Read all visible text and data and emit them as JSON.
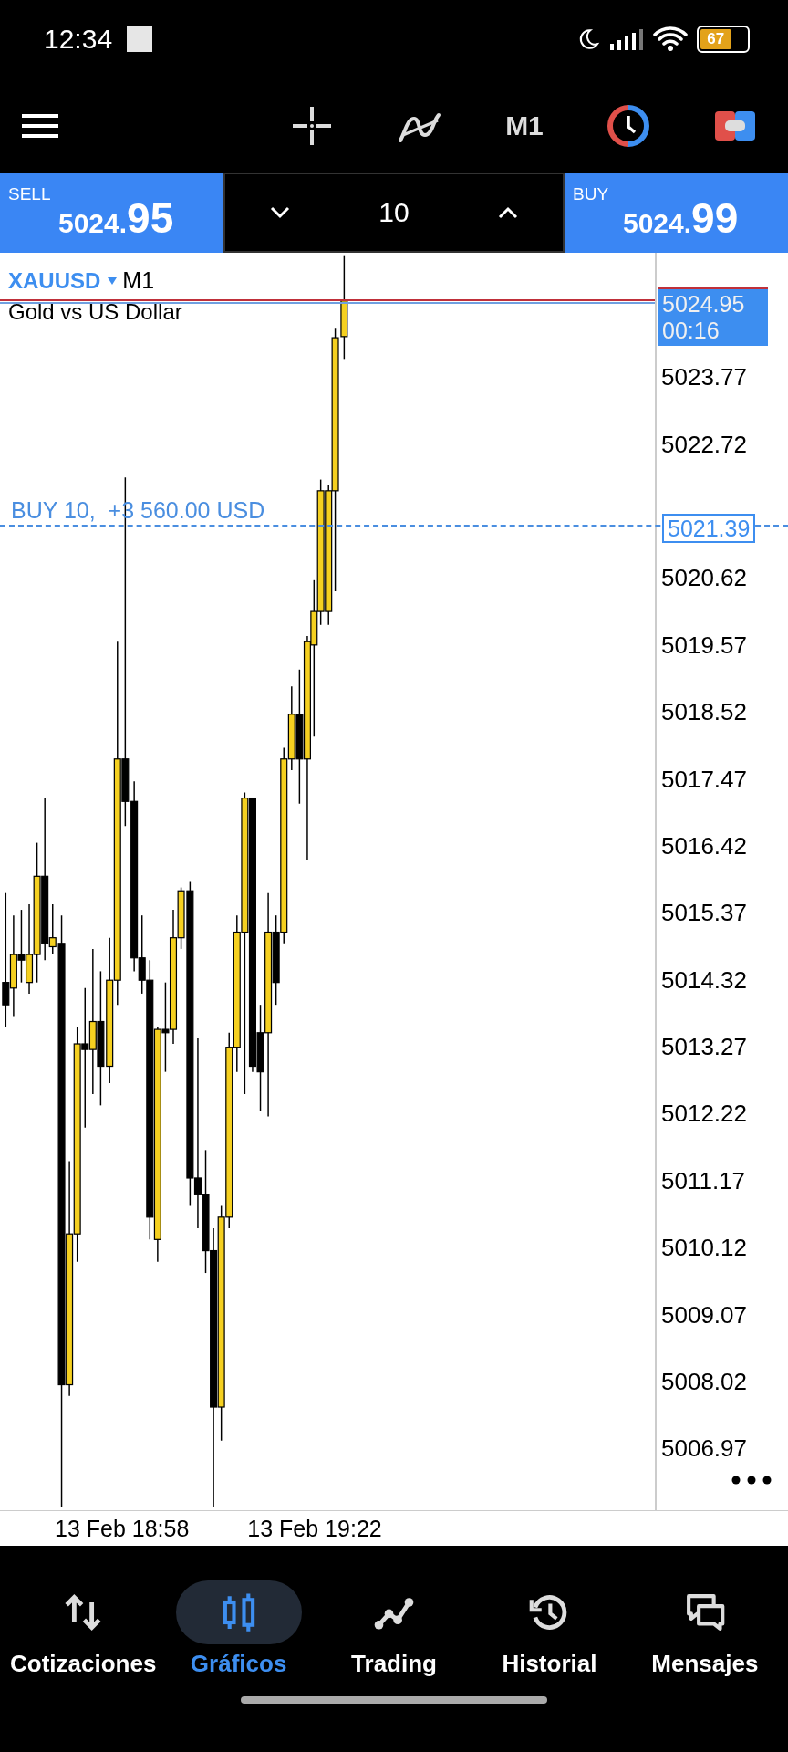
{
  "status_bar": {
    "time": "12:34",
    "battery": "67"
  },
  "toolbar": {
    "timeframe": "M1"
  },
  "trade_panel": {
    "sell": {
      "label": "SELL",
      "price_main": "5024.",
      "price_big": "95"
    },
    "volume": "10",
    "buy": {
      "label": "BUY",
      "price_main": "5024.",
      "price_big": "99"
    }
  },
  "chart": {
    "symbol": "XAUUSD",
    "timeframe": "M1",
    "description": "Gold vs US Dollar",
    "position_label": "BUY 10,  +3 560.00 USD",
    "current_price": "5024.95",
    "countdown": "00:16",
    "position_price": "5021.39",
    "price_axis_upper": [
      "5023.77",
      "5022.72"
    ],
    "price_axis_lower": [
      "5020.62",
      "5019.57",
      "5018.52",
      "5017.47",
      "5016.42",
      "5015.37",
      "5014.32",
      "5013.27",
      "5012.22",
      "5011.17",
      "5010.12",
      "5009.07",
      "5008.02",
      "5006.97"
    ],
    "time_axis": [
      "13 Feb 18:58",
      "13 Feb 19:22"
    ]
  },
  "nav": [
    {
      "label": "Cotizaciones",
      "kind": "quotes",
      "selected": false
    },
    {
      "label": "Gráficos",
      "kind": "charts",
      "selected": true
    },
    {
      "label": "Trading",
      "kind": "trading",
      "selected": false
    },
    {
      "label": "Historial",
      "kind": "history",
      "selected": false
    },
    {
      "label": "Mensajes",
      "kind": "messages",
      "selected": false
    }
  ]
}
